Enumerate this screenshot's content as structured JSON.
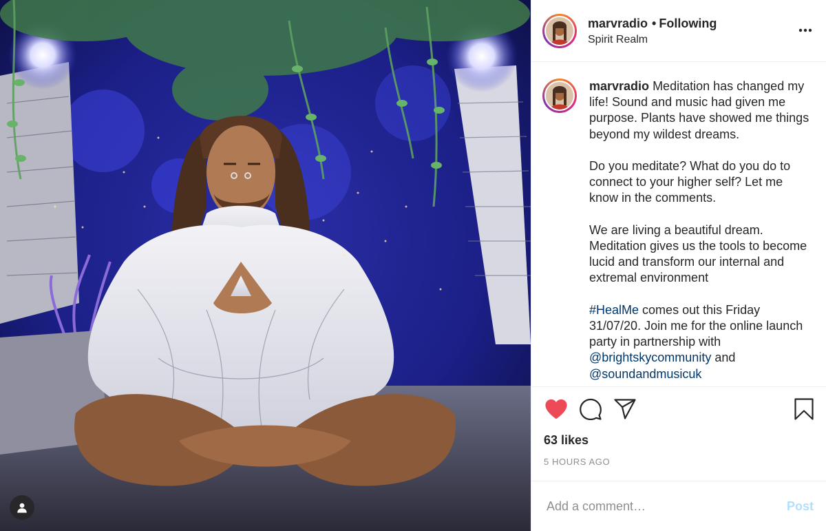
{
  "colors": {
    "like_red": "#ed4956",
    "link_blue": "#00376b",
    "post_disabled_blue": "#b2dffc",
    "muted_gray": "#8e8e8e"
  },
  "header": {
    "username": "marvradio",
    "follow_separator": "•",
    "follow_state": "Following",
    "location": "Spirit Realm",
    "more_icon": "more-horizontal-icon"
  },
  "caption": {
    "username": "marvradio",
    "paragraph_1": "Meditation has changed my life! Sound and music had given me purpose. Plants have showed me things beyond my wildest dreams.",
    "paragraph_2": "Do you meditate? What do you do to connect to your higher self? Let me know in the comments.",
    "paragraph_3": "We are living a beautiful dream. Meditation gives us the tools to become lucid and transform our internal and extremal environment",
    "paragraph_4": {
      "hashtag": "#HealMe",
      "text_1": " comes out this Friday 31/07/20. Join me for the online launch party in partnership with ",
      "mention_1": "@brightskycommunity",
      "text_2": " and ",
      "mention_2": "@soundandmusicuk"
    }
  },
  "actions": {
    "like_icon": "heart-filled-icon",
    "comment_icon": "comment-icon",
    "share_icon": "share-icon",
    "save_icon": "bookmark-icon",
    "liked": true
  },
  "likes": "63 likes",
  "timestamp": "5 HOURS AGO",
  "comment": {
    "placeholder": "Add a comment…",
    "post_label": "Post"
  }
}
